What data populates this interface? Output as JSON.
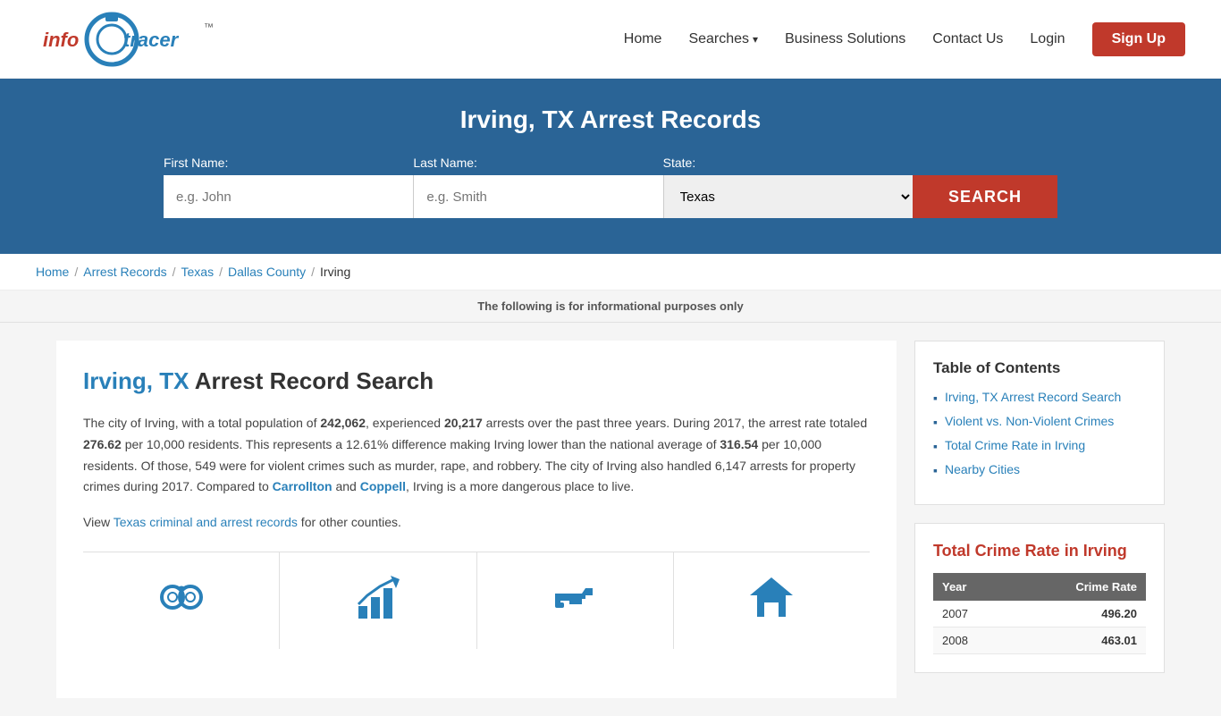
{
  "header": {
    "logo": {
      "info": "info",
      "tracer": "tracer",
      "tm": "™"
    },
    "nav": {
      "home": "Home",
      "searches": "Searches",
      "business_solutions": "Business Solutions",
      "contact_us": "Contact Us",
      "login": "Login",
      "signup": "Sign Up"
    }
  },
  "hero": {
    "title": "Irving, TX Arrest Records",
    "form": {
      "first_name_label": "First Name:",
      "first_name_placeholder": "e.g. John",
      "last_name_label": "Last Name:",
      "last_name_placeholder": "e.g. Smith",
      "state_label": "State:",
      "state_value": "Texas",
      "search_button": "SEARCH"
    }
  },
  "breadcrumb": {
    "home": "Home",
    "arrest_records": "Arrest Records",
    "texas": "Texas",
    "dallas_county": "Dallas County",
    "irving": "Irving"
  },
  "info_note": "The following is for informational purposes only",
  "content": {
    "heading_city": "Irving,",
    "heading_state": "TX",
    "heading_rest": "Arrest Record Search",
    "paragraphs": {
      "main": "The city of Irving, with a total population of 242,062, experienced 20,217 arrests over the past three years. During 2017, the arrest rate totaled 276.62 per 10,000 residents. This represents a 12.61% difference making Irving lower than the national average of 316.54 per 10,000 residents. Of those, 549 were for violent crimes such as murder, rape, and robbery. The city of Irving also handled 6,147 arrests for property crimes during 2017. Compared to Carrollton and Coppell, Irving is a more dangerous place to live.",
      "bold_population": "242,062",
      "bold_arrests": "20,217",
      "bold_rate": "276.62",
      "bold_national": "316.54",
      "city1": "Carrollton",
      "city2": "Coppell",
      "view_text": "View ",
      "view_link": "Texas criminal and arrest records",
      "view_suffix": " for other counties."
    }
  },
  "icons": [
    {
      "label": "",
      "icon_name": "handcuffs-icon"
    },
    {
      "label": "",
      "icon_name": "chart-up-icon"
    },
    {
      "label": "",
      "icon_name": "gun-icon"
    },
    {
      "label": "",
      "icon_name": "house-icon"
    }
  ],
  "sidebar": {
    "toc": {
      "title": "Table of Contents",
      "items": [
        {
          "label": "Irving, TX Arrest Record Search",
          "href": "#"
        },
        {
          "label": "Violent vs. Non-Violent Crimes",
          "href": "#"
        },
        {
          "label": "Total Crime Rate in Irving",
          "href": "#"
        },
        {
          "label": "Nearby Cities",
          "href": "#"
        }
      ]
    },
    "crime_rate": {
      "title": "Total Crime Rate in Irving",
      "table": {
        "col_year": "Year",
        "col_rate": "Crime Rate",
        "rows": [
          {
            "year": "2007",
            "rate": "496.20"
          },
          {
            "year": "2008",
            "rate": "463.01"
          }
        ]
      }
    }
  }
}
